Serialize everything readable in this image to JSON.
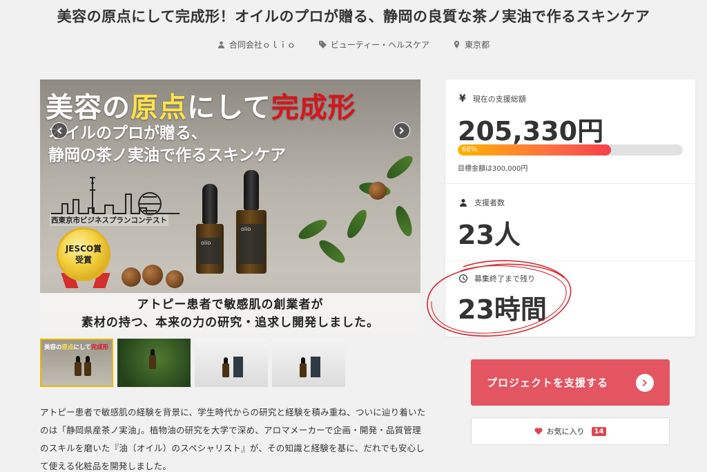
{
  "project": {
    "title": "美容の原点にして完成形！オイルのプロが贈る、静岡の良質な茶ノ実油で作るスキンケア",
    "owner": "合同会社ｏｌｉｏ",
    "category": "ビューティー・ヘルスケア",
    "location": "東京都"
  },
  "hero": {
    "headline_part1": "美容の",
    "headline_part2": "原点",
    "headline_part3": "にして",
    "headline_part4": "完成形",
    "sub_line1": "オイルのプロが贈る、",
    "sub_line2": "静岡の茶ノ実油で作るスキンケア",
    "contest": "西東京市ビジネスプランコンテスト",
    "award_line1": "JESCO賞",
    "award_line2": "受賞",
    "bottle_label": "olio",
    "bottom_line1": "アトピー患者で敏感肌の創業者が",
    "bottom_line2": "素材の持つ、本来の力の研究・追求し開発しました。"
  },
  "thumb1": {
    "part1": "美容の",
    "part2": "原点",
    "part3": "にして",
    "part4": "完成形"
  },
  "description": "アトピー患者で敏感肌の経験を背景に、学生時代からの研究と経験を積み重ね、ついに辿り着いたのは「静岡県産茶ノ実油」。植物油の研究を大学で深め、アロマメーカーで企画・開発・品質管理のスキルを磨いた『油（オイル）のスペシャリスト』が、その知識と経験を基に、だれでも安心して使える化粧品を開発しました。",
  "stats": {
    "total_label": "現在の支援総額",
    "total_value": "205,330円",
    "progress_label": "68%",
    "progress_fraction": 0.68,
    "goal_text": "目標金額は300,000円",
    "backers_label": "支援者数",
    "backers_value": "23人",
    "remaining_label": "募集終了まで残り",
    "remaining_value": "23時間"
  },
  "actions": {
    "support_label": "プロジェクトを支援する",
    "favorite_label": "お気に入り",
    "favorite_count": "14"
  },
  "icons": {
    "yen": "¥"
  },
  "colors": {
    "accent": "#e35561",
    "heart": "#e04452",
    "annotation": "#d8262e"
  }
}
